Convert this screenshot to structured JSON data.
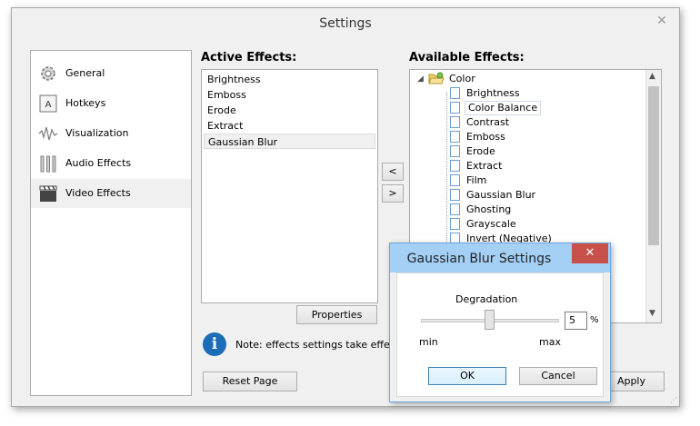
{
  "window": {
    "title": "Settings",
    "close_glyph": "✕"
  },
  "sidebar": {
    "items": [
      {
        "label": "General",
        "icon": "gear-icon"
      },
      {
        "label": "Hotkeys",
        "icon": "keyboard-key-icon"
      },
      {
        "label": "Visualization",
        "icon": "waveform-icon"
      },
      {
        "label": "Audio Effects",
        "icon": "equalizer-icon"
      },
      {
        "label": "Video Effects",
        "icon": "clapperboard-icon"
      }
    ],
    "selected_index": 4
  },
  "active_effects": {
    "heading": "Active Effects:",
    "items": [
      "Brightness",
      "Emboss",
      "Erode",
      "Extract",
      "Gaussian Blur"
    ],
    "selected_index": 4
  },
  "move_buttons": {
    "add_label": "<",
    "remove_label": ">"
  },
  "properties_button": {
    "label": "Properties"
  },
  "available_effects": {
    "heading": "Available Effects:",
    "group": "Color",
    "items": [
      "Brightness",
      "Color Balance",
      "Contrast",
      "Emboss",
      "Erode",
      "Extract",
      "Film",
      "Gaussian Blur",
      "Ghosting",
      "Grayscale",
      "Invert (Negative)"
    ],
    "focused_index": 1
  },
  "note": {
    "icon_glyph": "i",
    "text": "Note: effects settings take effect i"
  },
  "reset_button": {
    "label": "Reset Page"
  },
  "apply_button": {
    "label": "Apply"
  },
  "dialog": {
    "title": "Gaussian Blur Settings",
    "close_glyph": "✕",
    "param_label": "Degradation",
    "value": "5",
    "unit": "%",
    "min_label": "min",
    "max_label": "max",
    "slider_fraction": 0.5,
    "ok_label": "OK",
    "cancel_label": "Cancel"
  },
  "colors": {
    "dialog_title_bg": "#a4d0f5",
    "close_red": "#c7504a",
    "info_blue": "#1d6cb7"
  }
}
